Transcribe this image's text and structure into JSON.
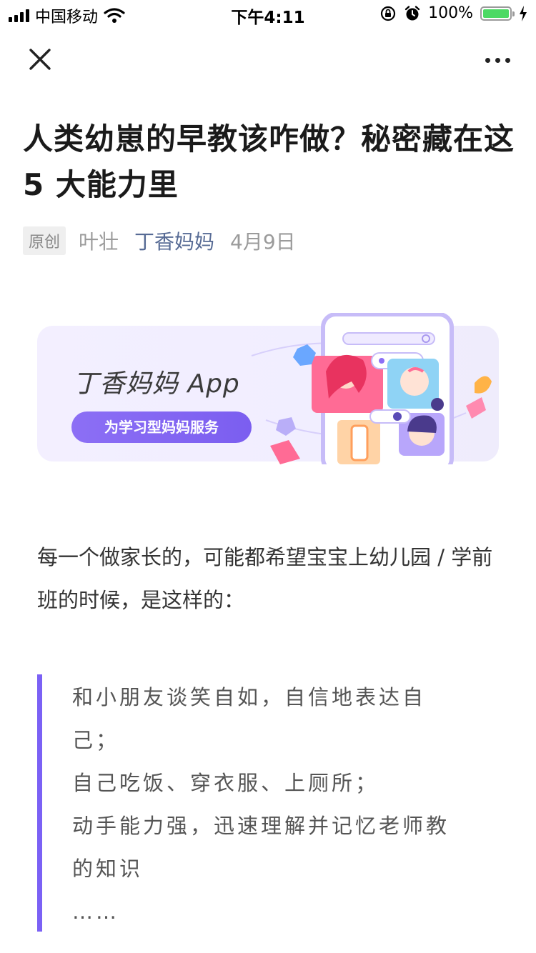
{
  "status_bar": {
    "carrier": "中国移动",
    "time": "下午4:11",
    "battery_percent": "100%",
    "battery_level": 1.0,
    "icons": [
      "signal-icon",
      "wifi-icon",
      "rotation-lock-icon",
      "alarm-icon",
      "battery-icon",
      "charging-bolt-icon"
    ]
  },
  "nav": {
    "close_icon": "close-icon",
    "more_icon": "more-icon"
  },
  "article": {
    "title": "人类幼崽的早教该咋做？秘密藏在这 5 大能力里",
    "tag": "原创",
    "author": "叶壮",
    "account": "丁香妈妈",
    "date": "4月9日"
  },
  "banner": {
    "title": "丁香妈妈 App",
    "slogan": "为学习型妈妈服务"
  },
  "body": {
    "intro": "每一个做家长的，可能都希望宝宝上幼儿园 / 学前班的时候，是这样的：",
    "quote_lines": [
      "和小朋友谈笑自如，自信地表达自己；",
      "自己吃饭、穿衣服、上厕所；",
      "动手能力强，迅速理解并记忆老师教的知识",
      "……"
    ]
  },
  "colors": {
    "accent": "#7b61f5",
    "link": "#576b95",
    "meta_gray": "#9b9b9b",
    "battery_green": "#4cd964"
  }
}
